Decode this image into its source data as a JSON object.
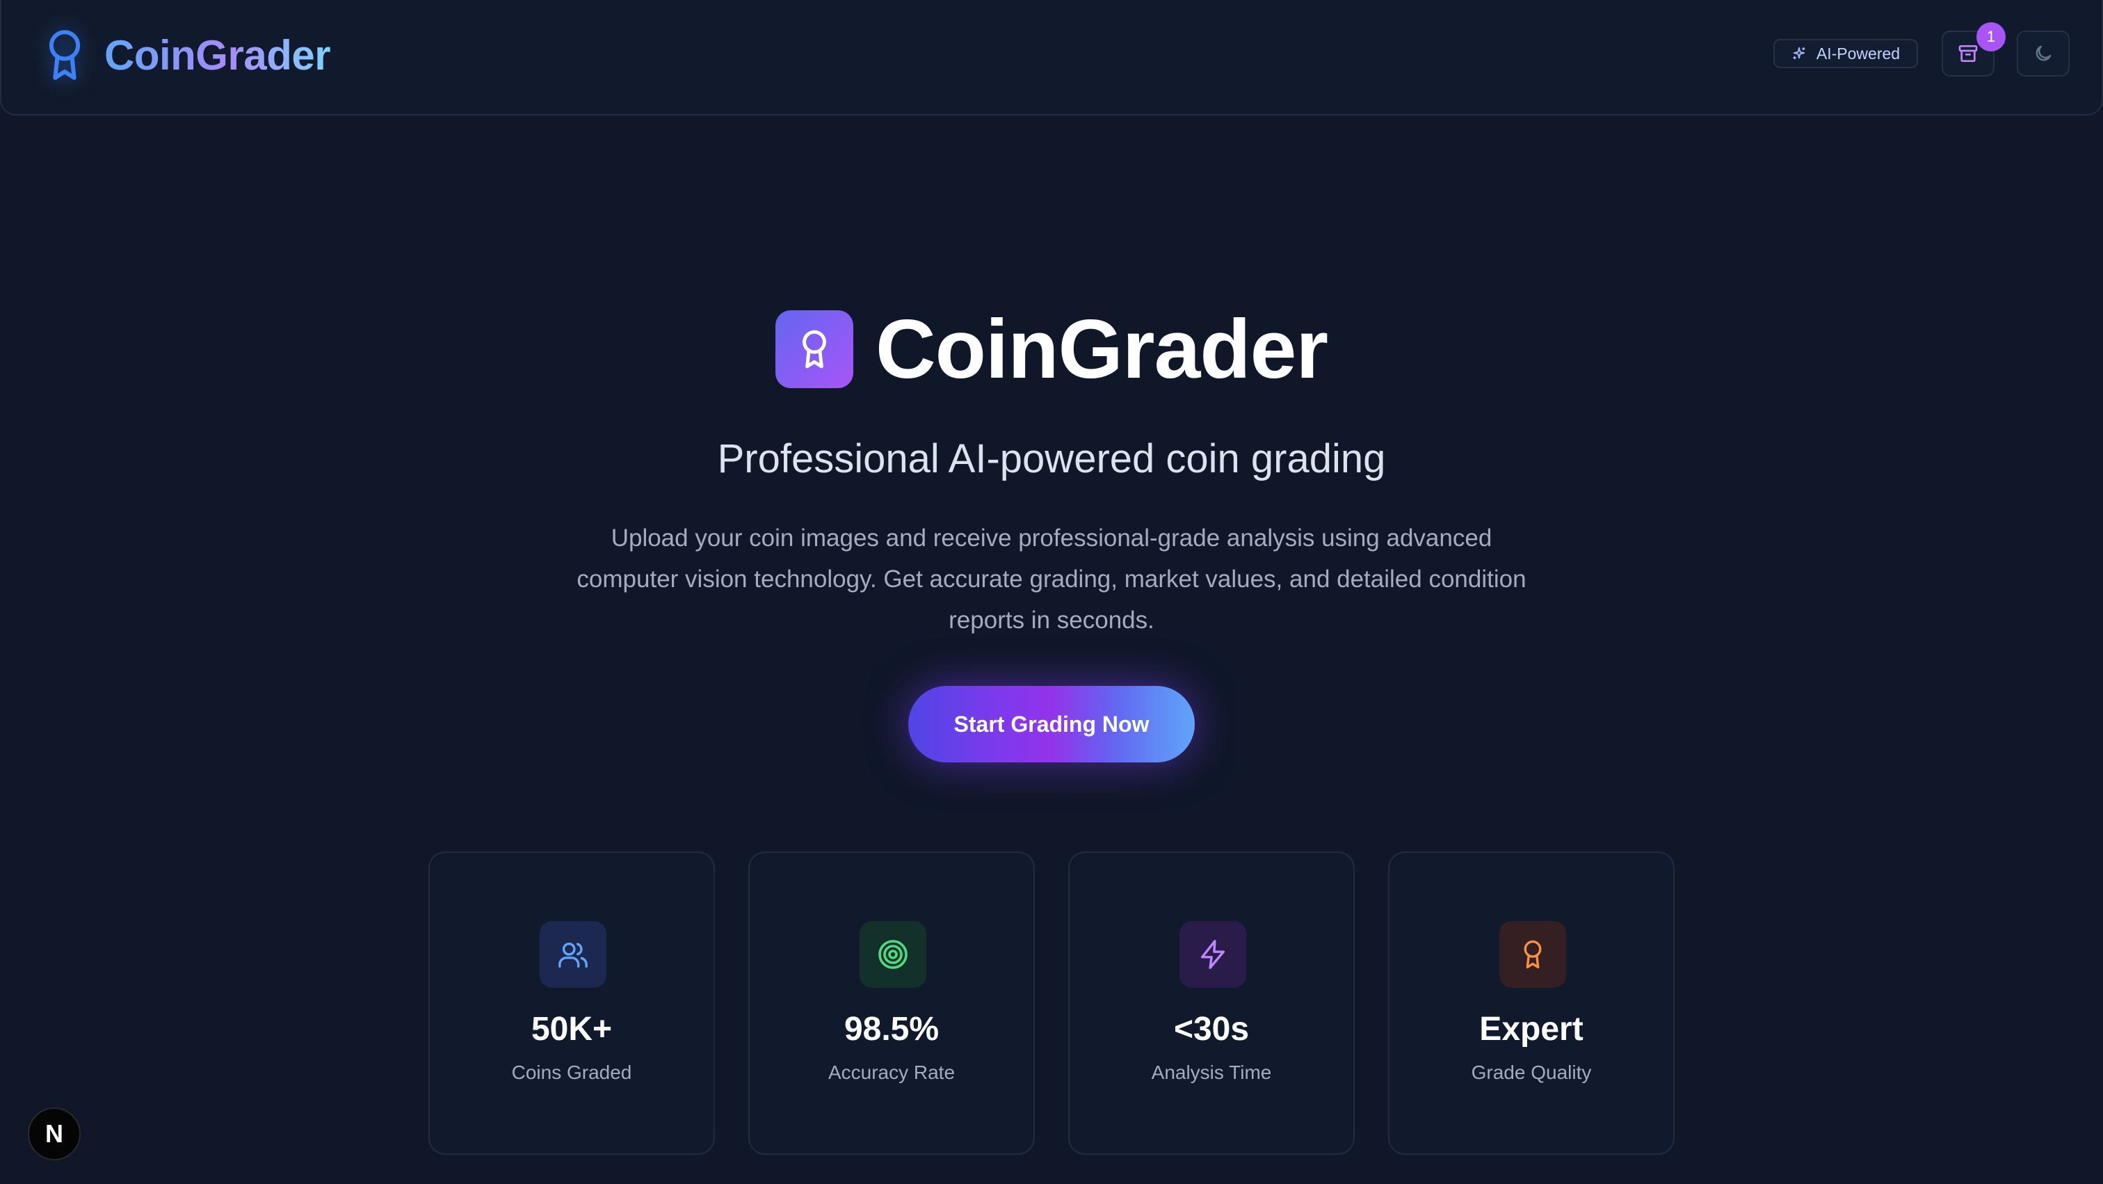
{
  "header": {
    "brand": "CoinGrader",
    "ai_badge": "AI-Powered",
    "notification_count": "1"
  },
  "hero": {
    "title": "CoinGrader",
    "subtitle": "Professional AI-powered coin grading",
    "description": "Upload your coin images and receive professional-grade analysis using advanced computer vision technology. Get accurate grading, market values, and detailed condition reports in seconds.",
    "cta_label": "Start Grading Now"
  },
  "stats": [
    {
      "value": "50K+",
      "label": "Coins Graded",
      "icon": "users-icon",
      "color": "#60a5fa"
    },
    {
      "value": "98.5%",
      "label": "Accuracy Rate",
      "icon": "target-icon",
      "color": "#4ade80"
    },
    {
      "value": "<30s",
      "label": "Analysis Time",
      "icon": "lightning-icon",
      "color": "#c084fc"
    },
    {
      "value": "Expert",
      "label": "Grade Quality",
      "icon": "award-icon",
      "color": "#fb923c"
    }
  ],
  "dev_badge": {
    "letter": "N"
  },
  "colors": {
    "background": "#0f1729",
    "accent_blue": "#60a5fa",
    "accent_purple": "#a855f7"
  }
}
